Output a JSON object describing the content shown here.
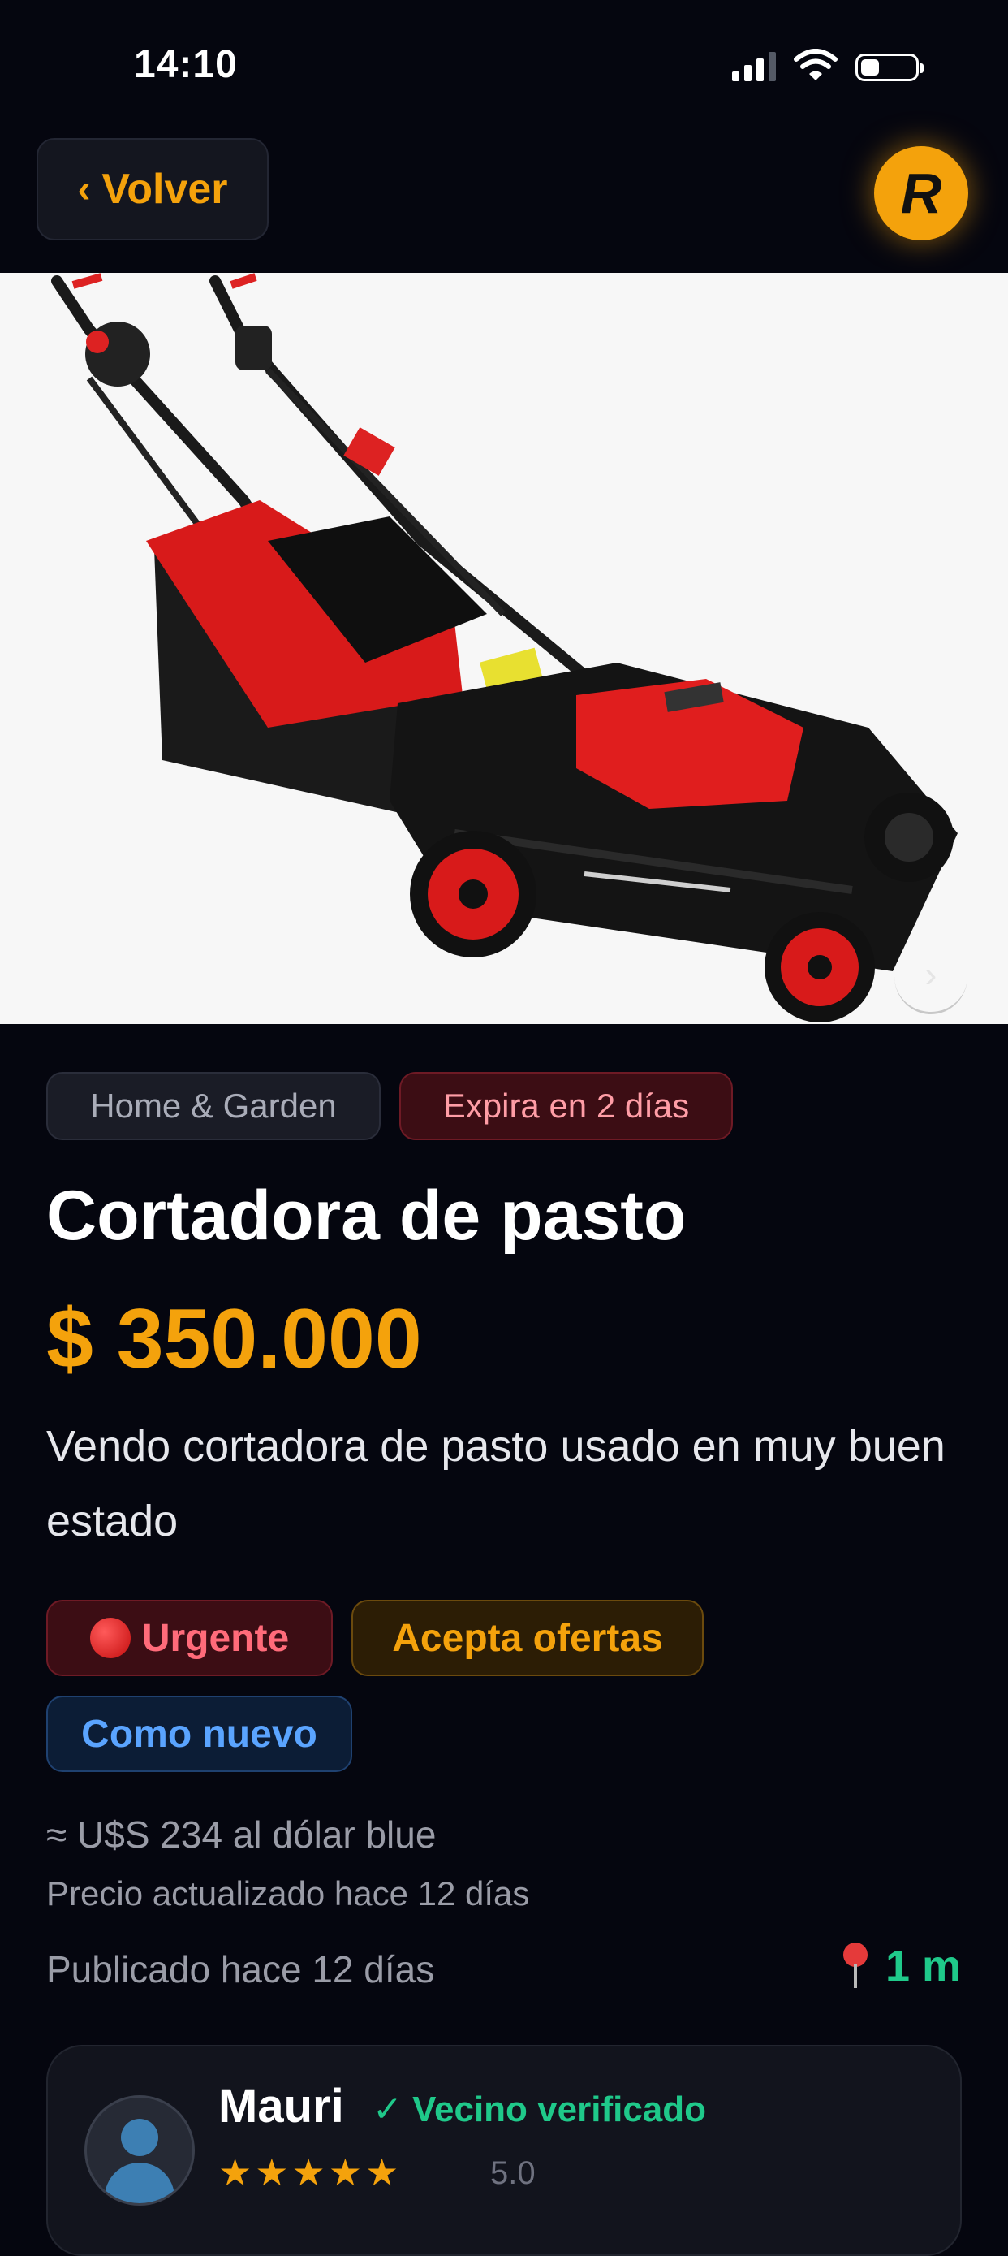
{
  "status_bar": {
    "time": "14:10",
    "battery_level": 0.35
  },
  "header": {
    "back_label": "Volver",
    "back_chevron": "‹",
    "logo_letter": "R"
  },
  "gallery": {
    "next_arrow": "›",
    "distance_chip": "1 m",
    "image_alt": "Cortadora de pasto roja",
    "accent": "#f4a20c"
  },
  "tags": {
    "category": "Home & Garden",
    "expiry": "Expira en 2 días"
  },
  "product": {
    "title": "Cortadora de pasto",
    "price": "$ 350.000",
    "description": "Vendo cortadora de pasto usado en muy buen estado"
  },
  "badges": {
    "urgent": "Urgente",
    "offers": "Acepta ofertas",
    "condition": "Como nuevo"
  },
  "meta": {
    "usd": "≈ U$S 234 al dólar blue",
    "updated": "Precio actualizado hace 12 días",
    "published": "Publicado hace 12 días",
    "distance": "1 m"
  },
  "seller": {
    "name": "Mauri",
    "verified": "✓ Vecino verificado",
    "stars": "★★★★★",
    "rating": "5.0"
  }
}
